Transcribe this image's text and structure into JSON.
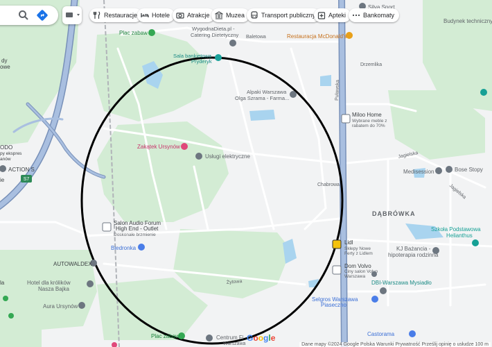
{
  "toolbar": {
    "chips": [
      {
        "label": "Restauracje",
        "icon": "restaurant-icon"
      },
      {
        "label": "Hotele",
        "icon": "hotel-icon"
      },
      {
        "label": "Atrakcje",
        "icon": "camera-icon"
      },
      {
        "label": "Muzea",
        "icon": "museum-icon"
      },
      {
        "label": "Transport publiczny",
        "icon": "transit-icon"
      },
      {
        "label": "Apteki",
        "icon": "pharmacy-icon"
      },
      {
        "label": "Bankomaty",
        "icon": "more-icon"
      }
    ]
  },
  "places": {
    "plac_zabaw_top": "Plac zabaw",
    "wygodna_dieta": "WygodnaDieta.pl -",
    "wygodna_dieta_2": "Catering Dietetyczny",
    "mcdonalds": "Restauracja McDonald's",
    "sala_bankietowa": "Sala bankietowa",
    "sala_bankietowa_2": "Pryderyk",
    "alpaki": "Alpaki Warszawa",
    "alpaki_2": "Olga Szrama - Farma...",
    "miloo": "Miloo Home",
    "miloo_2": "Wybrane meble z",
    "miloo_3": "rabatem do 70%",
    "zakatek": "Zakątek Ursynów",
    "uslugi": "Usługi elektryczne",
    "bose": "Bose Stopy",
    "medisession": "Medisession",
    "dabrowka": "DĄBRÓWKA",
    "szkola": "Szkoła Podstawowa",
    "szkola_2": "Helianthus",
    "salon_audio": "Salon Audio Forum",
    "salon_audio_2": "High End - Outlet",
    "salon_audio_3": "Doskonałe brzmienie",
    "biedronka": "Biedronka",
    "lidl_1": "Lidl",
    "lidl_2": "Sklepy Nowe",
    "lidl_3": "Ferty z Lidlem",
    "kj": "KJ Bażancia -",
    "kj_2": "hipoterapia rodzinna",
    "volvo": "Dom Volvo",
    "volvo_2": "Ciny salon Volvo",
    "volvo_3": "Warszawa",
    "autowaldex": "AUTOWALDEX",
    "hotel_krolikow": "Hotel dla królików",
    "hotel_krolikow_2": "Nasza Bajka",
    "aura": "Aura Ursynów",
    "dbi": "DBI-Warszawa Mysiadło",
    "selgros": "Selgros Warszawa",
    "selgros_2": "Piaseczno",
    "castorama": "Castorama",
    "plac_zabaw_bottom": "Plac zabaw",
    "centrum": "Centrum Fi",
    "centrum_2": "Warszawa",
    "silva": "Silva Sport",
    "budynek": "Budynek techniczny",
    "action": "ACTION S",
    "drzemlika": "Drzemlika",
    "chmielna": "Chabrowa",
    "jagielska": "Jagielska",
    "jagielska_2": "Jagielska",
    "puławska": "Puławska",
    "baletowa": "Baletowa",
    "zitowa": "Żytowa",
    "left_edge_1": "dy",
    "left_edge_2": "owe",
    "left_edge_3": "ODO",
    "left_edge_4": "py ekspres",
    "left_edge_5": "anów",
    "left_edge_6": "ie",
    "left_edge_7": "la"
  },
  "route_badge": "S7",
  "google_logo": "Google",
  "footer": "Dane mapy ©2024 Google  Polska  Warunki  Prywatność  Prześlij opinię o usłudze  100 m",
  "colors": {
    "map_bg": "#f2f3f4",
    "park": "#d3ecd4",
    "water": "#a9d4ef",
    "highway": "#8aa4c9",
    "highway_edge": "#7890b8",
    "road": "#ffffff",
    "circle": "#000000",
    "poi_gray": "#6d7680",
    "poi_teal": "#1aa29b",
    "poi_pink": "#e0487a",
    "poi_blue": "#4a7de8",
    "poi_orange": "#e8a019",
    "poi_green": "#34a853",
    "school_teal": "#16a095"
  }
}
